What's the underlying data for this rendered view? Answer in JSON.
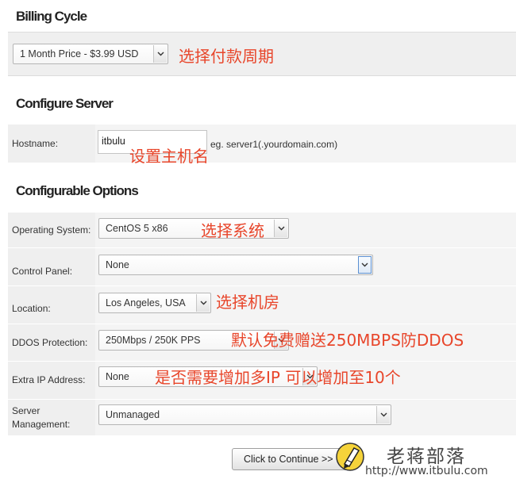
{
  "billing": {
    "title": "Billing Cycle",
    "select_value": "1 Month Price - $3.99 USD",
    "annotation": "选择付款周期"
  },
  "configure_server": {
    "title": "Configure Server",
    "hostname_label": "Hostname:",
    "hostname_value": "itbulu",
    "hostname_hint": "eg. server1(.yourdomain.com)",
    "annotation": "设置主机名"
  },
  "configurable_options": {
    "title": "Configurable Options",
    "rows": [
      {
        "label": "Operating System:",
        "value": "CentOS 5 x86",
        "annotation": "选择系统"
      },
      {
        "label": "Control Panel:",
        "value": "None",
        "annotation": ""
      },
      {
        "label": "Location:",
        "value": "Los Angeles, USA",
        "annotation": "选择机房"
      },
      {
        "label": "DDOS Protection:",
        "value": "250Mbps / 250K PPS",
        "annotation": "默认免费赠送250MBPS防DDOS"
      },
      {
        "label": "Extra IP Address:",
        "value": "None",
        "annotation": "是否需要增加多IP 可以增加至10个"
      },
      {
        "label": "Server Management:",
        "value": "Unmanaged",
        "annotation": ""
      }
    ]
  },
  "continue_button": {
    "label": "Click to Continue >>"
  },
  "watermark": {
    "name": "老蒋部落",
    "url": "http://www.itbulu.com"
  },
  "colors": {
    "annotation": "#e8462b",
    "panel": "#efefef",
    "focus_border": "#5a8fd1"
  },
  "icons": {
    "dropdown": "chevron-down-icon",
    "logo": "pencil-logo-icon"
  }
}
